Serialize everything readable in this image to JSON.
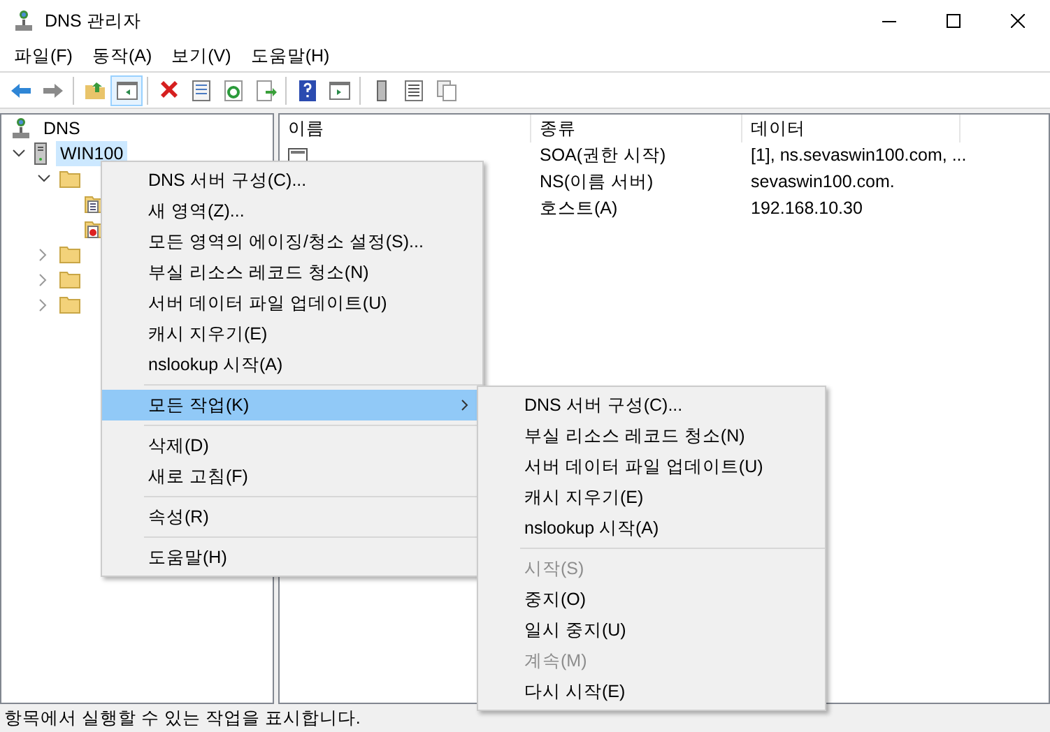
{
  "window": {
    "title": "DNS 관리자"
  },
  "menu_bar": [
    "파일(F)",
    "동작(A)",
    "보기(V)",
    "도움말(H)"
  ],
  "tree": {
    "label": "DNS",
    "children": [
      {
        "label": "WIN100",
        "selected": true,
        "expanded": true,
        "children": [
          {
            "kind": "folder",
            "expanded": true,
            "children": [
              {
                "kind": "zone"
              },
              {
                "kind": "zone-error"
              }
            ]
          },
          {
            "kind": "folder",
            "expanded": false
          },
          {
            "kind": "folder",
            "expanded": false
          },
          {
            "kind": "folder",
            "expanded": false
          }
        ]
      }
    ]
  },
  "table": {
    "columns": [
      "이름",
      "종류",
      "데이터"
    ],
    "rows": [
      {
        "kind": "record",
        "type": "SOA(권한 시작)",
        "data": "[1], ns.sevaswin100.com, ..."
      },
      {
        "kind": "plain",
        "type": "NS(이름 서버)",
        "data": "sevaswin100.com."
      },
      {
        "kind": "plain",
        "type": "호스트(A)",
        "data": "192.168.10.30"
      }
    ]
  },
  "context_menu": [
    {
      "label": "DNS 서버 구성(C)...",
      "kind": "item",
      "selected": false
    },
    {
      "label": "새 영역(Z)...",
      "kind": "item",
      "selected": false
    },
    {
      "label": "모든 영역의 에이징/청소 설정(S)...",
      "kind": "item",
      "selected": false
    },
    {
      "label": "부실 리소스 레코드 청소(N)",
      "kind": "item",
      "selected": false
    },
    {
      "label": "서버 데이터 파일 업데이트(U)",
      "kind": "item",
      "selected": false
    },
    {
      "label": "캐시 지우기(E)",
      "kind": "item",
      "selected": false
    },
    {
      "label": "nslookup 시작(A)",
      "kind": "item",
      "selected": false
    },
    {
      "kind": "separator"
    },
    {
      "label": "모든 작업(K)",
      "kind": "submenu",
      "selected": true
    },
    {
      "kind": "separator"
    },
    {
      "label": "삭제(D)",
      "kind": "item",
      "selected": false
    },
    {
      "label": "새로 고침(F)",
      "kind": "item",
      "selected": false
    },
    {
      "kind": "separator"
    },
    {
      "label": "속성(R)",
      "kind": "item",
      "selected": false
    },
    {
      "kind": "separator"
    },
    {
      "label": "도움말(H)",
      "kind": "item",
      "selected": false
    }
  ],
  "submenu": [
    {
      "label": "DNS 서버 구성(C)...",
      "disabled": false
    },
    {
      "label": "부실 리소스 레코드 청소(N)",
      "disabled": false
    },
    {
      "label": "서버 데이터 파일 업데이트(U)",
      "disabled": false
    },
    {
      "label": "캐시 지우기(E)",
      "disabled": false
    },
    {
      "label": "nslookup 시작(A)",
      "disabled": false
    },
    {
      "kind": "separator"
    },
    {
      "label": "시작(S)",
      "disabled": true
    },
    {
      "label": "중지(O)",
      "disabled": false
    },
    {
      "label": "일시 중지(U)",
      "disabled": false
    },
    {
      "label": "계속(M)",
      "disabled": true
    },
    {
      "label": "다시 시작(E)",
      "disabled": false
    }
  ],
  "status_bar": "항목에서 실행할 수 있는 작업을 표시합니다."
}
